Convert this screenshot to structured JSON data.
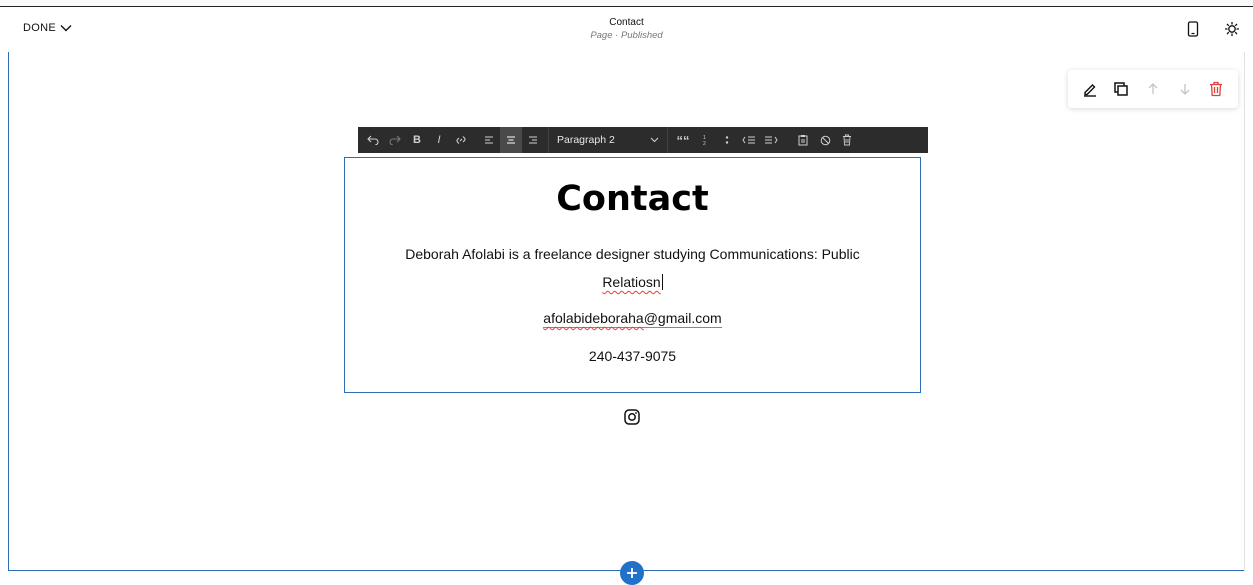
{
  "topbar": {
    "done_label": "DONE",
    "page_title": "Contact",
    "page_subtitle": "Page · Published",
    "icons": [
      "mobile-preview-icon",
      "settings-gear-icon"
    ]
  },
  "block_tools": {
    "icons": [
      "pencil-edit-icon",
      "duplicate-icon",
      "move-up-icon",
      "move-down-icon",
      "trash-delete-icon"
    ],
    "delete_color": "#e0413a"
  },
  "format_toolbar": {
    "paragraph_style": "Paragraph 2",
    "bold_label": "B",
    "italic_label": "I",
    "quote_label": "““",
    "icons": [
      "undo-icon",
      "redo-icon",
      "bold-icon",
      "italic-icon",
      "link-icon",
      "align-left-icon",
      "align-center-icon",
      "align-right-icon",
      "paragraph-style-select",
      "quote-icon",
      "numbered-list-icon",
      "bulleted-list-icon",
      "outdent-icon",
      "indent-icon",
      "paste-icon",
      "clear-format-icon",
      "delete-icon"
    ]
  },
  "content": {
    "heading": "Contact",
    "bio_line": "Deborah Afolabi is a freelance designer studying Communications: Public",
    "bio_misspelled": "Relatiosn",
    "email_misspelled": "afolabideboraha",
    "email_domain": "@gmail.com",
    "phone": "240-437-9075"
  },
  "colors": {
    "accent": "#2d6db3",
    "add_button": "#2271c9",
    "toolbar_bg": "#2c2c2c"
  }
}
